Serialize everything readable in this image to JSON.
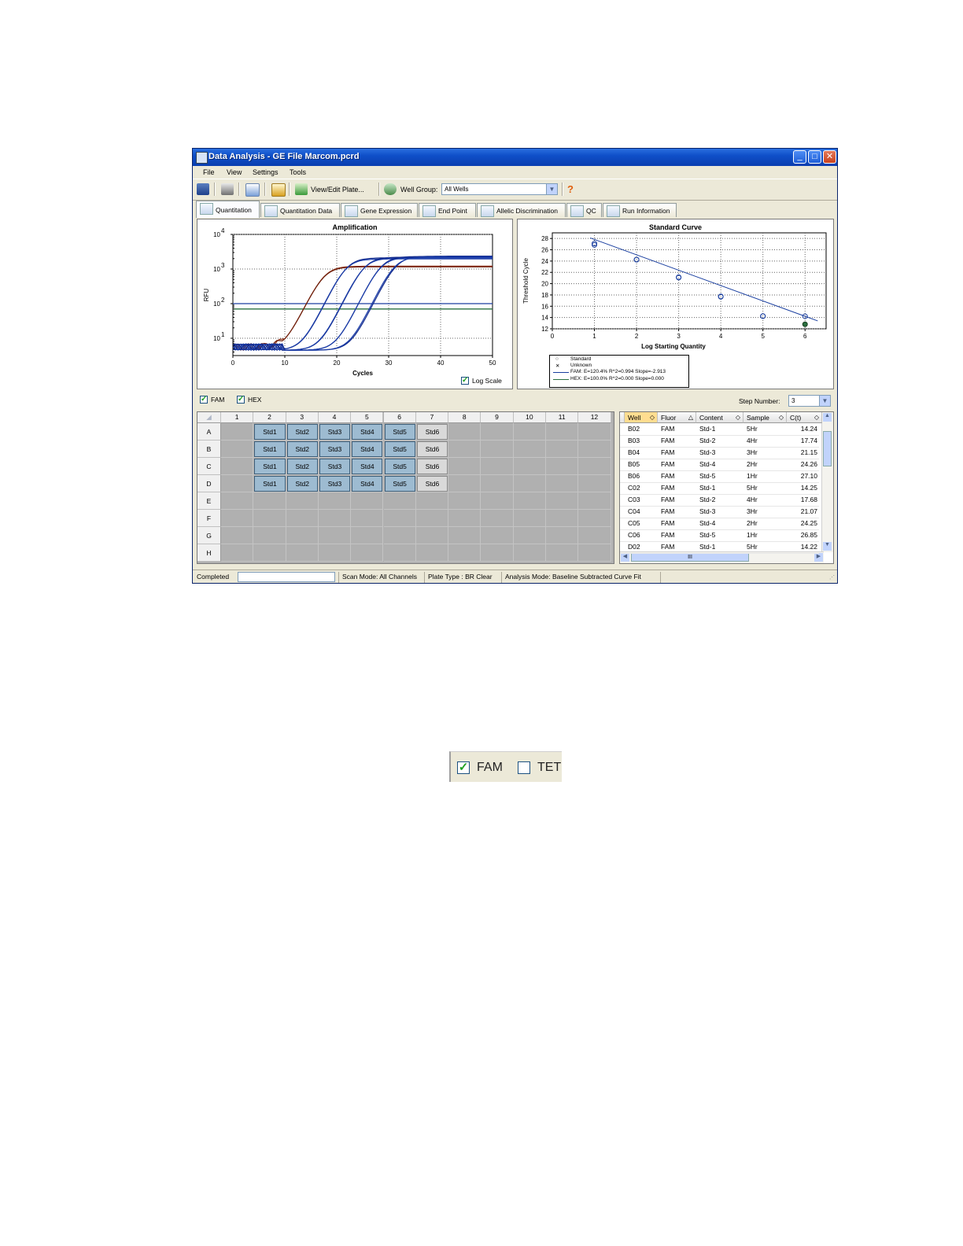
{
  "window": {
    "title": "Data Analysis - GE File Marcom.pcrd",
    "min_icon": "minimize-icon",
    "max_icon": "maximize-icon",
    "close_icon": "close-icon"
  },
  "menu": [
    "File",
    "View",
    "Settings",
    "Tools"
  ],
  "toolbar": {
    "view_edit_label": "View/Edit Plate...",
    "well_group_label": "Well Group:",
    "well_group_value": "All Wells",
    "help_glyph": "?"
  },
  "tabs": [
    "Quantitation",
    "Quantitation Data",
    "Gene Expression",
    "End Point",
    "Allelic Discrimination",
    "QC",
    "Run Information"
  ],
  "amplification": {
    "title": "Amplification",
    "xlabel": "Cycles",
    "ylabel": "RFU",
    "x_ticks": [
      "0",
      "10",
      "20",
      "30",
      "40",
      "50"
    ],
    "y_ticks": [
      "10",
      "10",
      "10",
      "10"
    ],
    "y_exps": [
      "4",
      "3",
      "2",
      "1"
    ],
    "log_scale_label": "Log Scale",
    "log_scale_checked": true
  },
  "standard_curve": {
    "title": "Standard Curve",
    "xlabel": "Log Starting Quantity",
    "ylabel": "Threshold Cycle",
    "x_ticks": [
      "0",
      "1",
      "2",
      "3",
      "4",
      "5",
      "6"
    ],
    "y_ticks": [
      "28",
      "26",
      "24",
      "22",
      "20",
      "18",
      "16",
      "14",
      "12"
    ],
    "legend": {
      "standard": "Standard",
      "unknown": "Unknown",
      "fam": "FAM: E=120.4% R^2=0.994 Slope=-2.913",
      "hex": "HEX: E=100.0% R^2=0.000 Slope=0.000"
    }
  },
  "chart_data": [
    {
      "type": "line",
      "title": "Amplification",
      "xlabel": "Cycles",
      "ylabel": "RFU",
      "xlim": [
        0,
        50
      ],
      "ylim_log10": [
        0.5,
        4
      ],
      "log_scale": true,
      "grid": true,
      "thresholds": [
        {
          "color": "#1a3fa0",
          "y": 100
        },
        {
          "color": "#2a7040",
          "y": 70
        }
      ],
      "series": [
        {
          "color": "#8a2a10",
          "ct": 14.24,
          "plateau": 1200
        },
        {
          "color": "#6e1e0a",
          "ct": 14.25,
          "plateau": 1150
        },
        {
          "color": "#10288a",
          "ct": 17.74,
          "plateau": 2100
        },
        {
          "color": "#1a3ca8",
          "ct": 17.68,
          "plateau": 1950
        },
        {
          "color": "#10288a",
          "ct": 21.15,
          "plateau": 2200
        },
        {
          "color": "#1a3ca8",
          "ct": 21.07,
          "plateau": 2050
        },
        {
          "color": "#10288a",
          "ct": 24.26,
          "plateau": 2300
        },
        {
          "color": "#1a3ca8",
          "ct": 24.25,
          "plateau": 2150
        },
        {
          "color": "#10288a",
          "ct": 27.1,
          "plateau": 2350
        },
        {
          "color": "#1a3ca8",
          "ct": 26.85,
          "plateau": 2250
        }
      ]
    },
    {
      "type": "scatter",
      "title": "Standard Curve",
      "xlabel": "Log Starting Quantity",
      "ylabel": "Threshold Cycle",
      "xlim": [
        0,
        6.5
      ],
      "ylim": [
        12,
        29
      ],
      "grid": true,
      "points": [
        {
          "x": 1,
          "y": 27.1
        },
        {
          "x": 1,
          "y": 26.85
        },
        {
          "x": 2,
          "y": 24.26
        },
        {
          "x": 2,
          "y": 24.25
        },
        {
          "x": 3,
          "y": 21.15
        },
        {
          "x": 3,
          "y": 21.07
        },
        {
          "x": 4,
          "y": 17.74
        },
        {
          "x": 4,
          "y": 17.68
        },
        {
          "x": 5,
          "y": 14.24
        },
        {
          "x": 5,
          "y": 14.25
        },
        {
          "x": 6,
          "y": 14.22
        },
        {
          "x": 6,
          "y": 12.8
        }
      ],
      "fit_line": {
        "x": [
          0.9,
          6.3
        ],
        "y": [
          28.1,
          13.4
        ]
      }
    }
  ],
  "fluors": {
    "fam_label": "FAM",
    "fam_checked": true,
    "hex_label": "HEX",
    "hex_checked": true,
    "step_label": "Step Number:",
    "step_value": "3"
  },
  "plate": {
    "columns": [
      "1",
      "2",
      "3",
      "4",
      "5",
      "6",
      "7",
      "8",
      "9",
      "10",
      "11",
      "12"
    ],
    "rows": [
      "A",
      "B",
      "C",
      "D",
      "E",
      "F",
      "G",
      "H"
    ],
    "well_labels": [
      "Std1",
      "Std2",
      "Std3",
      "Std4",
      "Std5",
      "Std6"
    ],
    "selected_color": "#9dbbd1",
    "unselected_color": "#d9d9d9",
    "empty_color": "#b0b0b0"
  },
  "table": {
    "headers": [
      "Well",
      "Fluor",
      "Content",
      "Sample",
      "C(t)"
    ],
    "rows": [
      [
        "B02",
        "FAM",
        "Std-1",
        "5Hr",
        "14.24"
      ],
      [
        "B03",
        "FAM",
        "Std-2",
        "4Hr",
        "17.74"
      ],
      [
        "B04",
        "FAM",
        "Std-3",
        "3Hr",
        "21.15"
      ],
      [
        "B05",
        "FAM",
        "Std-4",
        "2Hr",
        "24.26"
      ],
      [
        "B06",
        "FAM",
        "Std-5",
        "1Hr",
        "27.10"
      ],
      [
        "C02",
        "FAM",
        "Std-1",
        "5Hr",
        "14.25"
      ],
      [
        "C03",
        "FAM",
        "Std-2",
        "4Hr",
        "17.68"
      ],
      [
        "C04",
        "FAM",
        "Std-3",
        "3Hr",
        "21.07"
      ],
      [
        "C05",
        "FAM",
        "Std-4",
        "2Hr",
        "24.25"
      ],
      [
        "C06",
        "FAM",
        "Std-5",
        "1Hr",
        "26.85"
      ],
      [
        "D02",
        "FAM",
        "Std-1",
        "5Hr",
        "14.22"
      ]
    ],
    "hscroll_glyph": "III"
  },
  "status": {
    "completed": "Completed",
    "scan_mode": "Scan Mode: All Channels",
    "plate_type": "Plate Type : BR Clear",
    "analysis_mode": "Analysis Mode: Baseline Subtracted Curve Fit"
  },
  "snippet": {
    "fam_label": "FAM",
    "fam_checked": true,
    "tet_label": "TET",
    "tet_checked": false
  }
}
